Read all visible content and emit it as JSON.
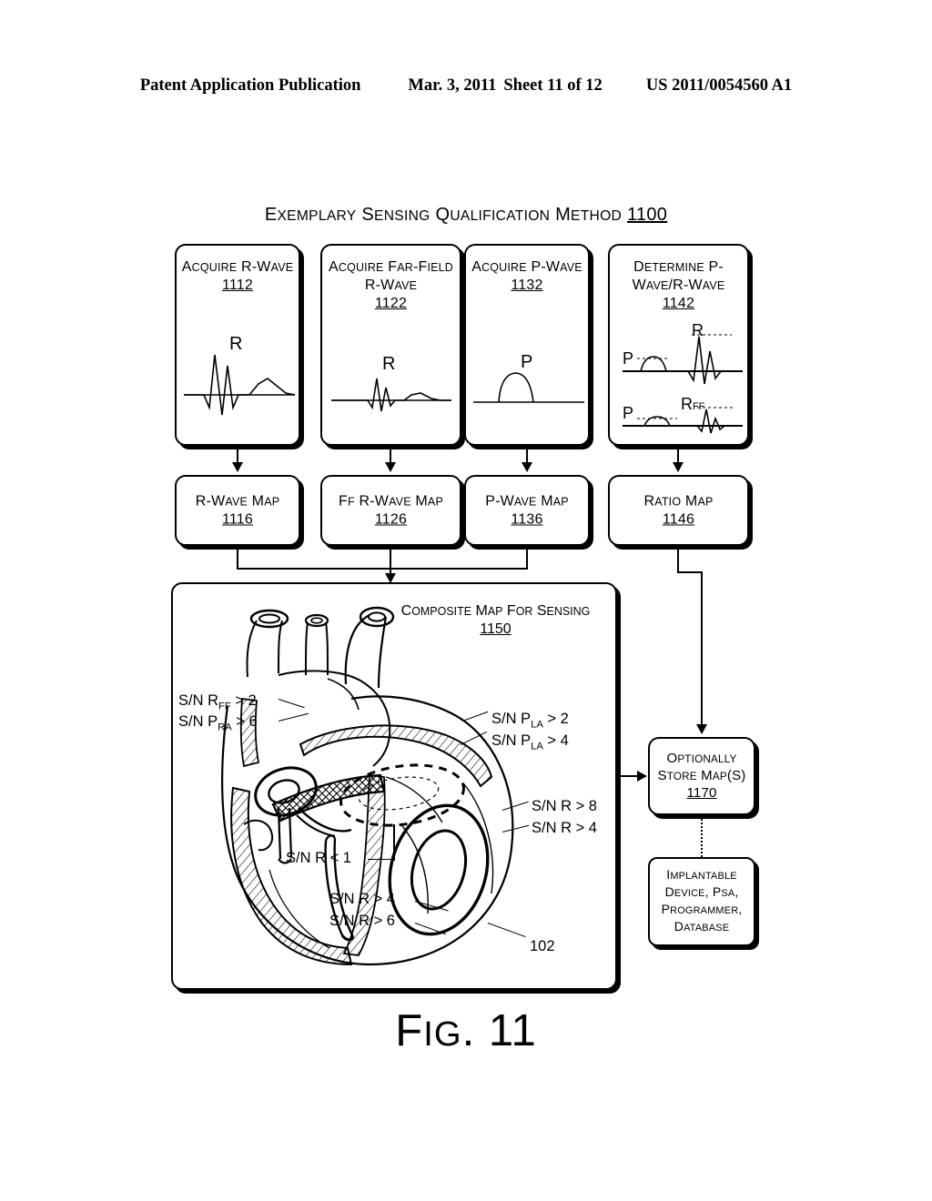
{
  "header": {
    "publication": "Patent Application Publication",
    "date": "Mar. 3, 2011",
    "sheet": "Sheet 11 of 12",
    "patent_number": "US 2011/0054560 A1"
  },
  "figure": {
    "title_text": "Exemplary Sensing Qualification Method",
    "title_number": "1100",
    "caption": "FIG. 11"
  },
  "top_row": [
    {
      "name": "acquire-r-wave",
      "lines": [
        "Acquire",
        "R-Wave"
      ],
      "number": "1112",
      "waveform": "qrs-with-t",
      "wave_labels": [
        "R"
      ]
    },
    {
      "name": "acquire-far-field-r-wave",
      "lines": [
        "Acquire",
        "Far-Field",
        "R-Wave"
      ],
      "number": "1122",
      "waveform": "small-qrs",
      "wave_labels": [
        "R"
      ]
    },
    {
      "name": "acquire-p-wave",
      "lines": [
        "Acquire",
        "P-Wave"
      ],
      "number": "1132",
      "waveform": "p-bump",
      "wave_labels": [
        "P"
      ]
    },
    {
      "name": "determine-p-wave-r-wave",
      "lines": [
        "Determine",
        "P-Wave/R-Wave"
      ],
      "number": "1142",
      "waveform": "ratio-pair",
      "wave_labels": [
        "P",
        "R",
        "P",
        "R",
        "FF"
      ]
    }
  ],
  "map_row": [
    {
      "name": "r-wave-map",
      "lines": [
        "R-Wave Map"
      ],
      "number": "1116"
    },
    {
      "name": "ff-r-wave-map",
      "lines": [
        "FF R-Wave",
        "Map"
      ],
      "number": "1126"
    },
    {
      "name": "p-wave-map",
      "lines": [
        "P-Wave",
        "Map"
      ],
      "number": "1136"
    },
    {
      "name": "ratio-map",
      "lines": [
        "Ratio Map"
      ],
      "number": "1146"
    }
  ],
  "composite": {
    "label_lines": [
      "Composite Map",
      "for Sensing"
    ],
    "label_number": "1150",
    "reference_numeral": "102",
    "annotations": [
      {
        "name": "sn-rff-gt-2",
        "text_html": "S/N R<sub>FF</sub> > 2",
        "plain": "S/N RFF > 2"
      },
      {
        "name": "sn-pra-gt-6",
        "text_html": "S/N P<sub>RA</sub> > 6",
        "plain": "S/N PRA > 6"
      },
      {
        "name": "sn-pla-gt-2",
        "text_html": "S/N P<sub>LA</sub> > 2",
        "plain": "S/N PLA > 2"
      },
      {
        "name": "sn-pla-gt-4",
        "text_html": "S/N P<sub>LA</sub> > 4",
        "plain": "S/N PLA > 4"
      },
      {
        "name": "sn-r-gt-8",
        "text_html": "S/N R > 8",
        "plain": "S/N R > 8"
      },
      {
        "name": "sn-r-gt-4-right",
        "text_html": "S/N R > 4",
        "plain": "S/N R > 4"
      },
      {
        "name": "sn-r-lt-1",
        "text_html": "S/N R < 1",
        "plain": "S/N R < 1"
      },
      {
        "name": "sn-r-gt-4-bottom",
        "text_html": "S/N R > 4",
        "plain": "S/N R > 4"
      },
      {
        "name": "sn-r-gt-6",
        "text_html": "S/N R > 6",
        "plain": "S/N R > 6"
      }
    ]
  },
  "right_column": [
    {
      "name": "optionally-store-maps",
      "lines": [
        "Optionally",
        "Store Map(s)"
      ],
      "number": "1170"
    },
    {
      "name": "implantable-device-database",
      "lines": [
        "Implantable",
        "Device, PSA,",
        "Programmer,",
        "Database"
      ],
      "number": ""
    }
  ],
  "colors": {
    "ink": "#000000",
    "paper": "#ffffff"
  }
}
